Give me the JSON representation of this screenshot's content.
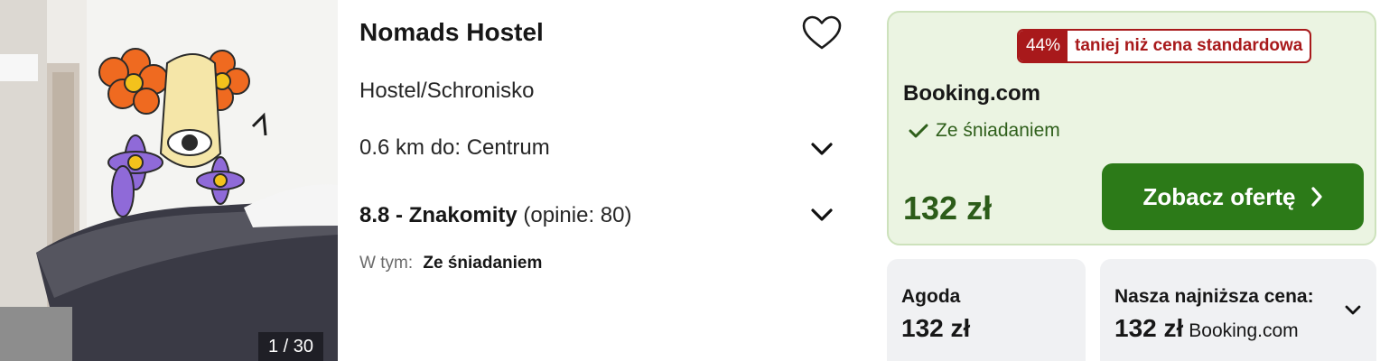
{
  "photo": {
    "counter": "1 / 30"
  },
  "hotel": {
    "name": "Nomads Hostel",
    "type": "Hostel/Schronisko",
    "distance": "0.6 km do: Centrum",
    "rating_score": "8.8 - Znakomity",
    "rating_reviews": "(opinie: 80)",
    "includes_label": "W tym:",
    "includes_value": "Ze śniadaniem"
  },
  "icons": {
    "favorite": "heart-outline-icon",
    "expand": "chevron-down-icon",
    "check": "checkmark-icon",
    "arrow": "chevron-right-icon"
  },
  "offer": {
    "discount_pct": "44%",
    "discount_text": "taniej niż cena standardowa",
    "provider": "Booking.com",
    "feature": "Ze śniadaniem",
    "price": "132 zł",
    "cta": "Zobacz ofertę"
  },
  "alternatives": [
    {
      "label": "Agoda",
      "price": "132 zł",
      "provider": ""
    },
    {
      "label": "Nasza najniższa cena:",
      "price": "132 zł",
      "provider": "Booking.com"
    }
  ],
  "colors": {
    "offer_bg": "#ebf4e2",
    "offer_border": "#cde2bc",
    "cta_bg": "#2c7a18",
    "price_green": "#2c5c19",
    "deal_red": "#a8191b",
    "alt_bg": "#f0f1f3"
  }
}
